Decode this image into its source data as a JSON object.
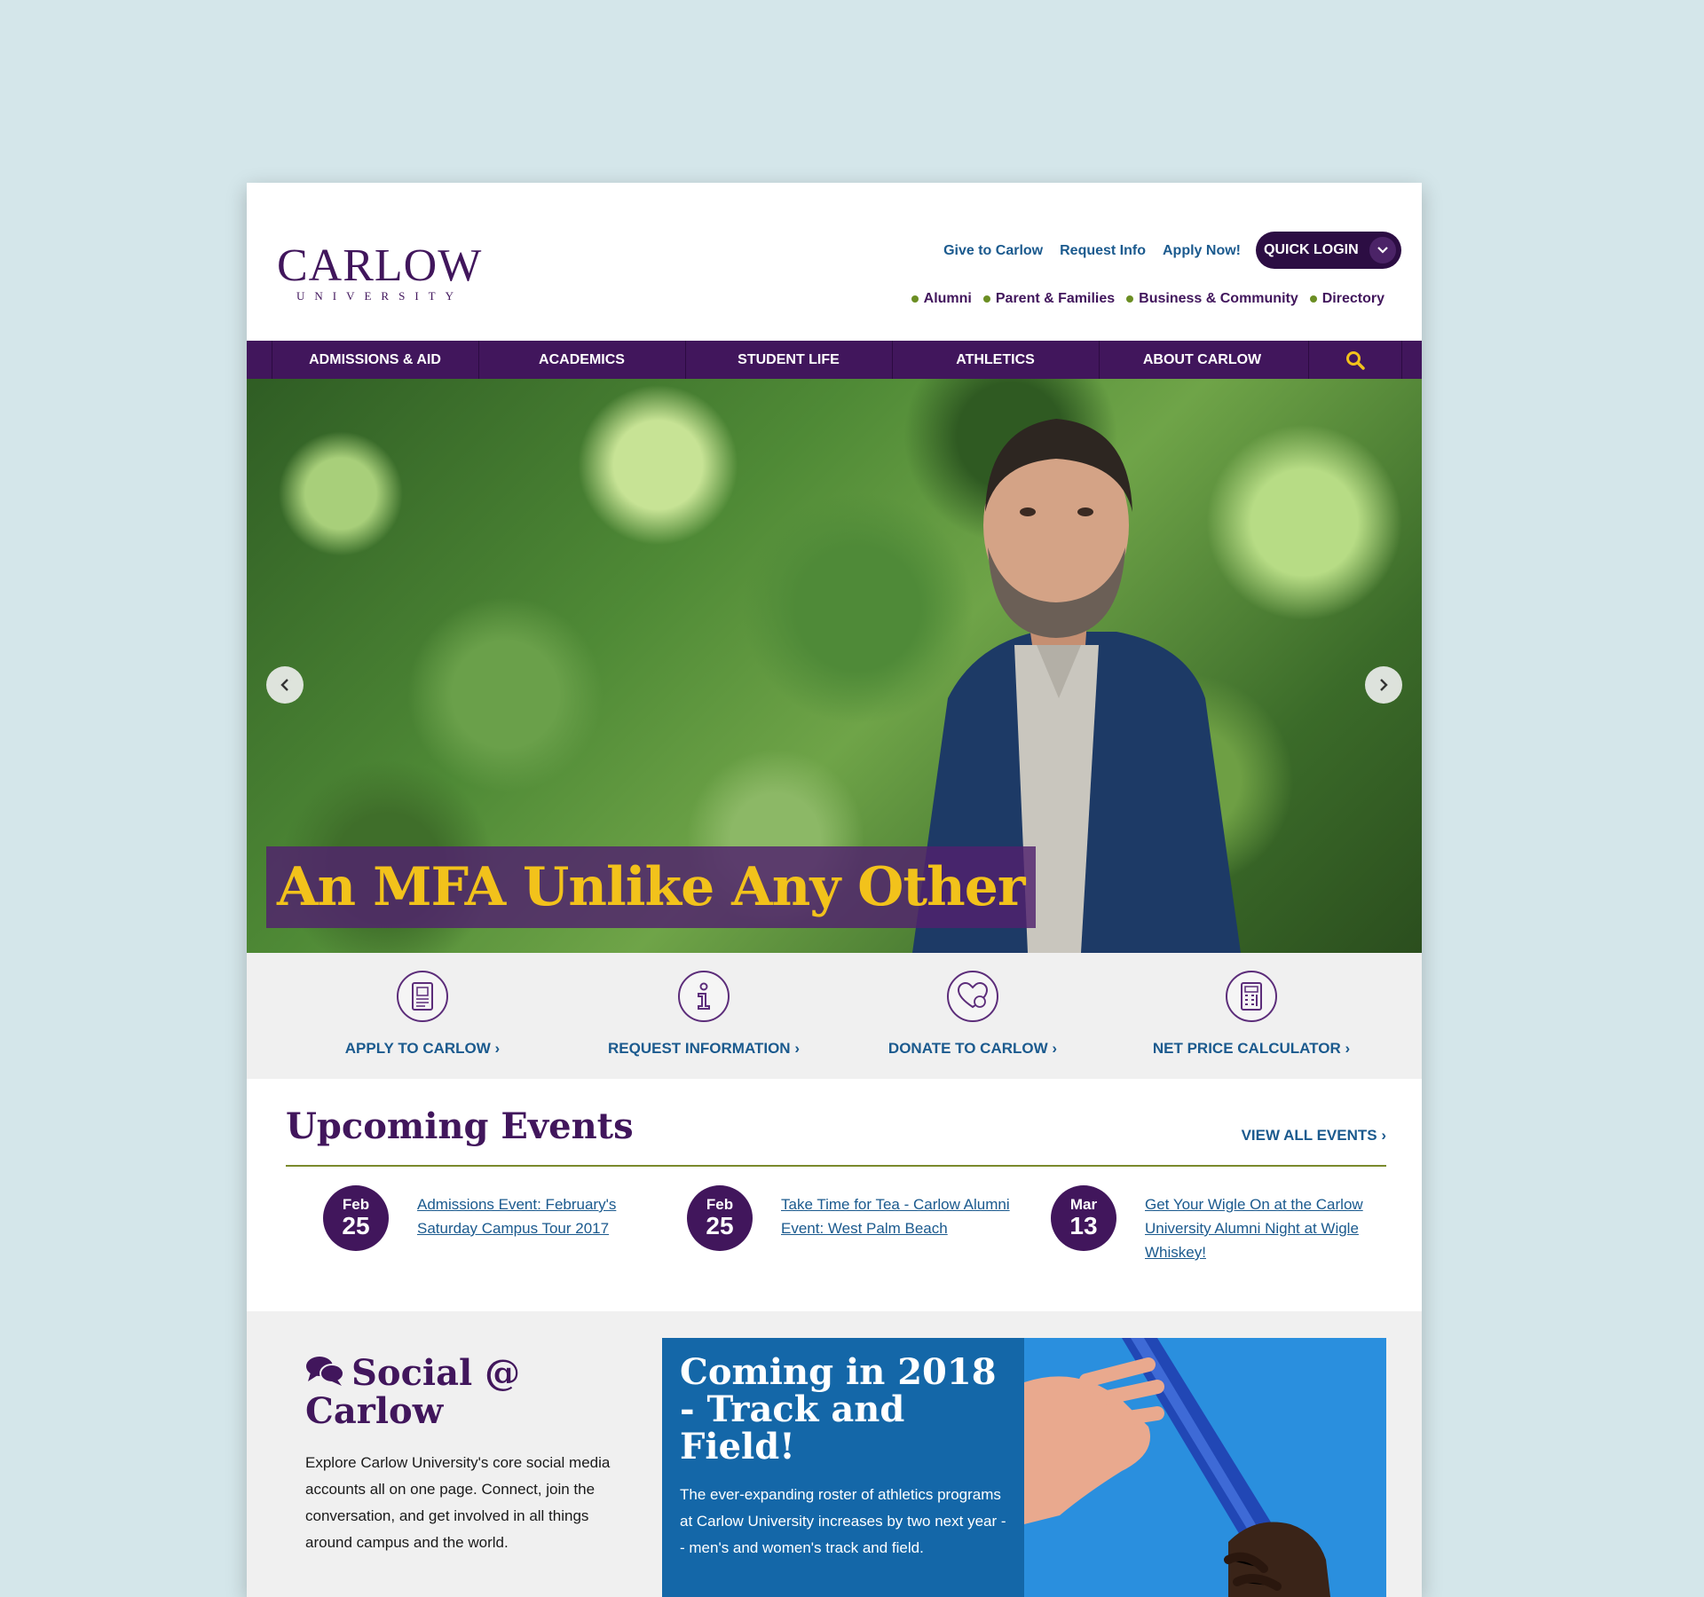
{
  "header": {
    "logo_main": "CARLOW",
    "logo_sub": "UNIVERSITY",
    "util_links": [
      "Give to Carlow",
      "Request Info",
      "Apply Now!"
    ],
    "quick_login": "QUICK LOGIN",
    "audience_links": [
      "Alumni",
      "Parent & Families",
      "Business & Community",
      "Directory"
    ]
  },
  "nav": {
    "items": [
      "ADMISSIONS & AID",
      "ACADEMICS",
      "STUDENT LIFE",
      "ATHLETICS",
      "ABOUT CARLOW"
    ],
    "search_icon": "search-icon"
  },
  "hero": {
    "caption": "An MFA Unlike Any Other"
  },
  "actions": [
    {
      "label": "APPLY TO CARLOW",
      "icon": "application-form-icon"
    },
    {
      "label": "REQUEST INFORMATION",
      "icon": "info-icon"
    },
    {
      "label": "DONATE TO CARLOW",
      "icon": "heart-donation-icon"
    },
    {
      "label": "NET PRICE CALCULATOR",
      "icon": "calculator-icon"
    }
  ],
  "events": {
    "title": "Upcoming Events",
    "view_all": "VIEW ALL EVENTS",
    "items": [
      {
        "month": "Feb",
        "day": "25",
        "title": "Admissions Event: February's Saturday Campus Tour 2017"
      },
      {
        "month": "Feb",
        "day": "25",
        "title": "Take Time for Tea - Carlow Alumni Event: West Palm Beach"
      },
      {
        "month": "Mar",
        "day": "13",
        "title": "Get Your Wigle On at the Carlow University Alumni Night at Wigle Whiskey!"
      }
    ]
  },
  "social": {
    "title": "Social @ Carlow",
    "text": "Explore Carlow University's core social media accounts all on one page. Connect, join the conversation, and get involved in all things around campus and the world."
  },
  "feature": {
    "title": "Coming in 2018 - Track and Field!",
    "text": "The ever-expanding roster of athletics programs at Carlow University increases by two next year -- men's and women's track and field."
  },
  "colors": {
    "purple": "#41165c",
    "gold": "#f2c21b",
    "link_blue": "#1b5a8e",
    "feature_blue": "#1467a8"
  }
}
